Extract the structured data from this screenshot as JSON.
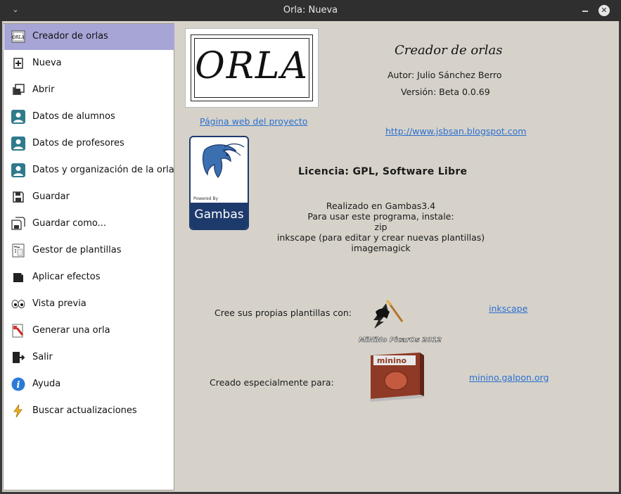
{
  "window": {
    "title": "Orla: Nueva"
  },
  "sidebar": {
    "items": [
      {
        "label": "Creador de orlas",
        "icon": "orla-icon",
        "active": true
      },
      {
        "label": "Nueva",
        "icon": "new-icon"
      },
      {
        "label": "Abrir",
        "icon": "open-icon"
      },
      {
        "label": "Datos de alumnos",
        "icon": "user-icon"
      },
      {
        "label": "Datos de profesores",
        "icon": "user-icon"
      },
      {
        "label": "Datos y organización de la orla",
        "icon": "user-icon"
      },
      {
        "label": "Guardar",
        "icon": "save-icon"
      },
      {
        "label": "Guardar como...",
        "icon": "save-as-icon"
      },
      {
        "label": "Gestor de plantillas",
        "icon": "template-icon"
      },
      {
        "label": "Aplicar efectos",
        "icon": "effects-icon"
      },
      {
        "label": "Vista previa",
        "icon": "eyes-icon"
      },
      {
        "label": "Generar una orla",
        "icon": "generate-icon"
      },
      {
        "label": "Salir",
        "icon": "exit-icon"
      },
      {
        "label": "Ayuda",
        "icon": "info-icon"
      },
      {
        "label": "Buscar actualizaciones",
        "icon": "update-icon"
      }
    ]
  },
  "about": {
    "logo_text": "ORLA",
    "logo_small": "ORLA",
    "title": "Creador de orlas",
    "author": "Autor: Julio Sánchez Berro",
    "version": "Versión: Beta 0.0.69",
    "project_link": "Página web del proyecto",
    "blog_link": "http://www.jsbsan.blogspot.com",
    "license": "Licencia: GPL, Software Libre",
    "gambas_label": "Gambas",
    "gambas_powered": "Powered By",
    "info_lines": [
      "Realizado en Gambas3.4",
      "Para usar este programa, instale:",
      "zip",
      "inkscape (para editar y crear nuevas plantillas)",
      "imagemagick"
    ],
    "templates_label": "Cree sus propias plantillas con:",
    "inkscape_link": "inkscape",
    "inkscape_caption": "MiNiNo PicarOs 2012",
    "made_for_label": "Creado especialmente para:",
    "minino_link": "minino.galpon.org",
    "minino_box_text": "minino"
  },
  "colors": {
    "sidebar_active": "#a7a5d6",
    "link": "#2a6fd0",
    "gambas_blue": "#1d3a6d"
  }
}
